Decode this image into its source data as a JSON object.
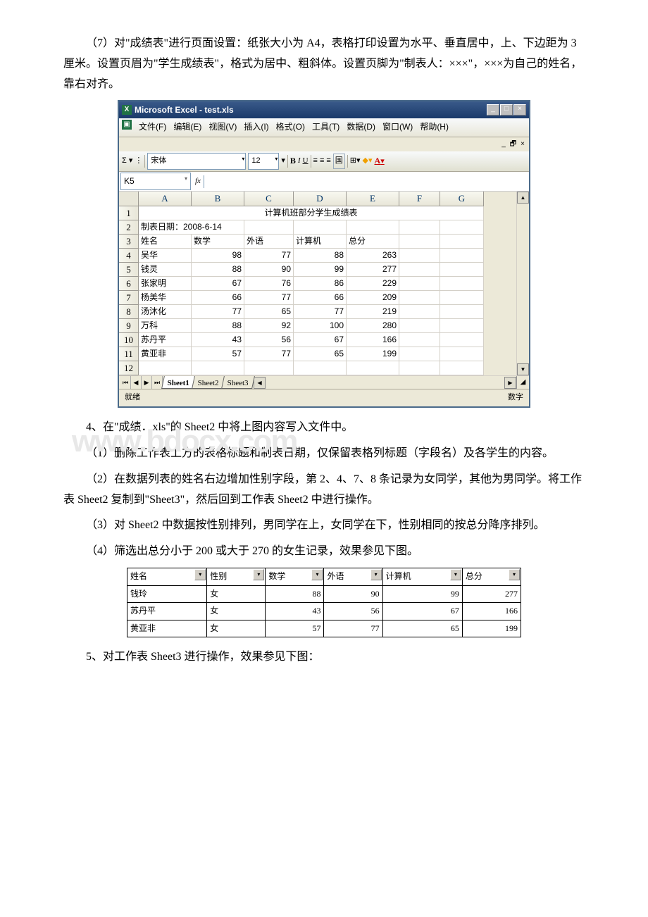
{
  "paragraphs": {
    "p1": "（7）对\"成绩表\"进行页面设置：纸张大小为 A4，表格打印设置为水平、垂直居中，上、下边距为 3 厘米。设置页眉为\"学生成绩表\"，格式为居中、粗斜体。设置页脚为\"制表人：×××\"，×××为自己的姓名，靠右对齐。",
    "p4": "4、在\"成绩．xls\"的 Sheet2 中将上图内容写入文件中。",
    "p41": "（1）删除工作表上方的表格标题和制表日期，仅保留表格列标题（字段名）及各学生的内容。",
    "p42": "（2）在数据列表的姓名右边增加性别字段，第 2、4、7、8 条记录为女同学，其他为男同学。将工作表 Sheet2 复制到\"Sheet3\"，然后回到工作表 Sheet2 中进行操作。",
    "p43": "（3）对 Sheet2 中数据按性别排列，男同学在上，女同学在下，性别相同的按总分降序排列。",
    "p44": "（4）筛选出总分小于 200 或大于 270 的女生记录，效果参见下图。",
    "p5": "5、对工作表 Sheet3 进行操作，效果参见下图："
  },
  "excel": {
    "title": "Microsoft Excel - test.xls",
    "menus": [
      "文件(F)",
      "编辑(E)",
      "视图(V)",
      "插入(I)",
      "格式(O)",
      "工具(T)",
      "数据(D)",
      "窗口(W)",
      "帮助(H)"
    ],
    "font_name": "宋体",
    "font_size": "12",
    "name_box": "K5",
    "columns": [
      "A",
      "B",
      "C",
      "D",
      "E",
      "F",
      "G"
    ],
    "title_row": "计算机班部分学生成绩表",
    "date_row": "制表日期：2008-6-14",
    "headers": [
      "姓名",
      "数学",
      "外语",
      "计算机",
      "总分"
    ],
    "rows": [
      {
        "n": 4,
        "name": "吴华",
        "b": 98,
        "c": 77,
        "d": 88,
        "e": 263
      },
      {
        "n": 5,
        "name": "钱灵",
        "b": 88,
        "c": 90,
        "d": 99,
        "e": 277
      },
      {
        "n": 6,
        "name": "张家明",
        "b": 67,
        "c": 76,
        "d": 86,
        "e": 229
      },
      {
        "n": 7,
        "name": "杨美华",
        "b": 66,
        "c": 77,
        "d": 66,
        "e": 209
      },
      {
        "n": 8,
        "name": "汤沐化",
        "b": 77,
        "c": 65,
        "d": 77,
        "e": 219
      },
      {
        "n": 9,
        "name": "万科",
        "b": 88,
        "c": 92,
        "d": 100,
        "e": 280
      },
      {
        "n": 10,
        "name": "苏丹平",
        "b": 43,
        "c": 56,
        "d": 67,
        "e": 166
      },
      {
        "n": 11,
        "name": "黄亚非",
        "b": 57,
        "c": 77,
        "d": 65,
        "e": 199
      }
    ],
    "sheets": [
      "Sheet1",
      "Sheet2",
      "Sheet3"
    ],
    "status_left": "就绪",
    "status_right": "数字"
  },
  "filter": {
    "headers": [
      "姓名",
      "性别",
      "数学",
      "外语",
      "计算机",
      "总分"
    ],
    "rows": [
      {
        "name": "钱玲",
        "sex": "女",
        "a": 88,
        "b": 90,
        "c": 99,
        "d": 277
      },
      {
        "name": "苏丹平",
        "sex": "女",
        "a": 43,
        "b": 56,
        "c": 67,
        "d": 166
      },
      {
        "name": "黄亚非",
        "sex": "女",
        "a": 57,
        "b": 77,
        "c": 65,
        "d": 199
      }
    ]
  }
}
